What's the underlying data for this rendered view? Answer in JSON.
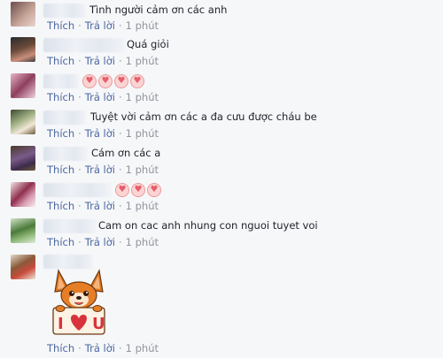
{
  "actions": {
    "like": "Thích",
    "reply": "Trả lời",
    "separator": "·"
  },
  "comments": [
    {
      "text": "Tình người cảm ơn các anh",
      "time": "1 phút"
    },
    {
      "text": "Quá giỏi",
      "time": "1 phút"
    },
    {
      "text": "",
      "time": "1 phút",
      "hearts": [
        "♥",
        "♥",
        "♥",
        "♥"
      ]
    },
    {
      "text": "Tuyệt vời cảm ơn các a đa cưu được cháu be",
      "time": "1 phút"
    },
    {
      "text": "Cám ơn các a",
      "time": "1 phút"
    },
    {
      "text": "",
      "time": "1 phút",
      "hearts": [
        "♥",
        "♥",
        "♥"
      ]
    },
    {
      "text": "Cam on cac anh nhung con nguoi tuyet voi",
      "time": "1 phút"
    },
    {
      "text": "",
      "time": "1 phút",
      "sticker": "i-love-u-fox-sticker"
    }
  ],
  "colors": {
    "link": "#4b67a1",
    "meta": "#90949c",
    "background": "#f6f7f9"
  }
}
